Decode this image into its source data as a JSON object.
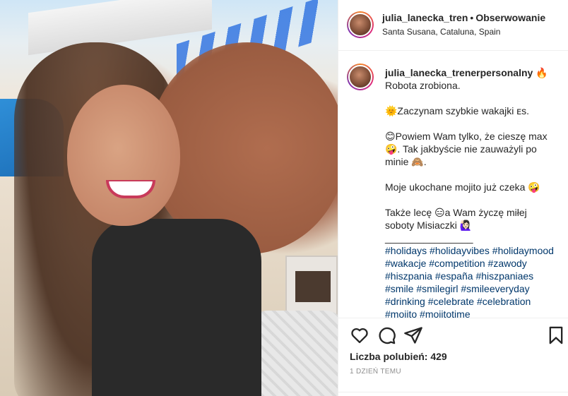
{
  "post": {
    "author": {
      "username": "julia_lanecka_tren",
      "follow_separator": "•",
      "follow_label": "Obserwowanie",
      "location": "Santa Susana, Cataluna, Spain"
    },
    "caption": {
      "username": "julia_lanecka_trenerpersonalny",
      "username_emoji": "🔥",
      "lines": [
        "Robota zrobiona.",
        "",
        "🌞Zaczynam szybkie wakajki ᴇs.",
        "",
        "😊Powiem Wam tylko, że cieszę max",
        "🤪. Tak jakbyście nie zauważyli po",
        "minie 🙈.",
        "",
        "Moje ukochane mojito już czeka 🤪",
        "",
        "Także lecę 😑a Wam życzę miłej",
        "soboty Misiaczki 🙋🏻‍♀️",
        "________________"
      ],
      "hashtags": [
        "#holidays",
        "#holidayvibes",
        "#holidaymood",
        "#wakacje",
        "#competition",
        "#zawody",
        "#hiszpania",
        "#españa",
        "#hiszpaniaes",
        "#smile",
        "#smilegirl",
        "#smileeveryday",
        "#drinking",
        "#celebrate",
        "#celebration",
        "#mojito",
        "#mojitotime"
      ]
    },
    "actions": {
      "like_icon": "heart-icon",
      "comment_icon": "comment-icon",
      "share_icon": "share-icon",
      "save_icon": "bookmark-icon"
    },
    "likes_label": "Liczba polubień: 429",
    "timestamp": "1 DZIEŃ TEMU"
  }
}
